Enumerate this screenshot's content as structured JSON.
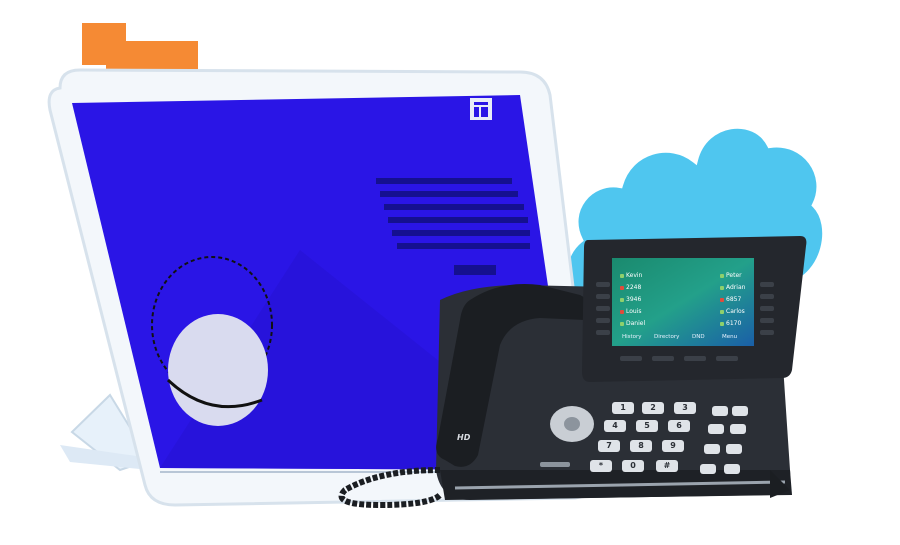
{
  "colors": {
    "orange": "#f58a34",
    "screen_blue": "#2a15e6",
    "cloud_blue": "#4fc6ef",
    "phone_body": "#2b2f36"
  },
  "icons": [
    "orange-square-icon",
    "cloud-icon",
    "window-icon",
    "lines-icon"
  ],
  "phone": {
    "badge": "HD",
    "contacts_left": [
      {
        "name": "Kevin",
        "status": "green"
      },
      {
        "name": "2248",
        "status": "red"
      },
      {
        "name": "3946",
        "status": "green"
      },
      {
        "name": "Louis",
        "status": "red"
      },
      {
        "name": "Daniel",
        "status": "green"
      }
    ],
    "contacts_right": [
      {
        "name": "Peter",
        "status": "green"
      },
      {
        "name": "Adrian",
        "status": "green"
      },
      {
        "name": "6857",
        "status": "red"
      },
      {
        "name": "Carlos",
        "status": "green"
      },
      {
        "name": "6170",
        "status": "green"
      }
    ],
    "softkeys": [
      "History",
      "Directory",
      "DND",
      "Menu"
    ],
    "keypad": [
      "1",
      "2",
      "3",
      "4",
      "5",
      "6",
      "7",
      "8",
      "9",
      "*",
      "0",
      "#"
    ]
  }
}
